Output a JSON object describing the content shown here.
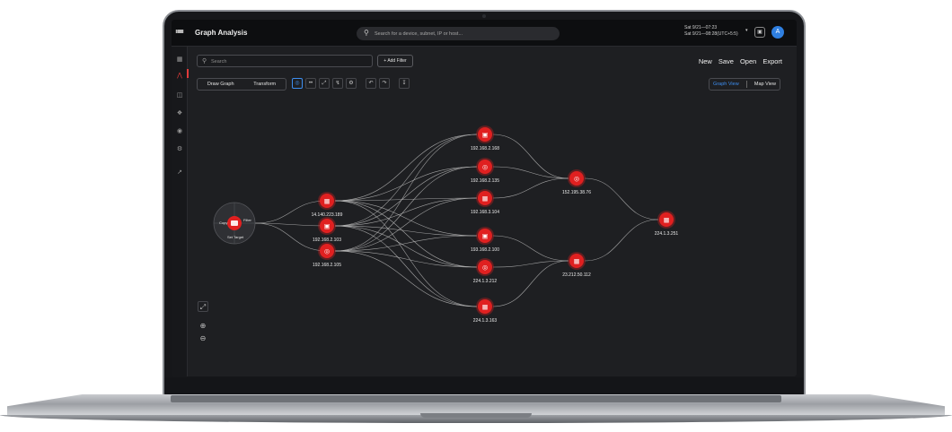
{
  "app": {
    "title": "Graph Analysis",
    "search_placeholder": "Search for a device, subnet, IP or host...",
    "datetime_line1": "Sat 9/21—07:23",
    "datetime_line2": "Sat 9/21—08:28(UTC+5:5)",
    "avatar_initial": "A"
  },
  "toolbar": {
    "search_placeholder": "Search",
    "add_filter_label": "+ Add Filter",
    "actions": [
      "New",
      "Save",
      "Open",
      "Export"
    ],
    "tabs": [
      "Draw Graph",
      "Transform"
    ],
    "view_options": [
      "Graph View",
      "Map View"
    ],
    "active_view": "Graph View"
  },
  "hub": {
    "copy_label": "Copy",
    "filter_label": "Filter",
    "set_target_label": "Set Target"
  },
  "colors": {
    "node": "#e02020",
    "accent": "#3d8ef0",
    "edge": "#b9b9b9"
  },
  "graph": {
    "layer1": [
      "14.140.223.189",
      "192.168.2.103",
      "192.168.2.105"
    ],
    "layer2": [
      "192.168.2.168",
      "192.168.2.135",
      "192.168.3.104",
      "193.168.2.100",
      "224.1.3.212",
      "224.1.3.163"
    ],
    "layer3": [
      "152.195.38.76",
      "23.212.50.112"
    ],
    "layer4": [
      "224.1.3.251"
    ]
  }
}
